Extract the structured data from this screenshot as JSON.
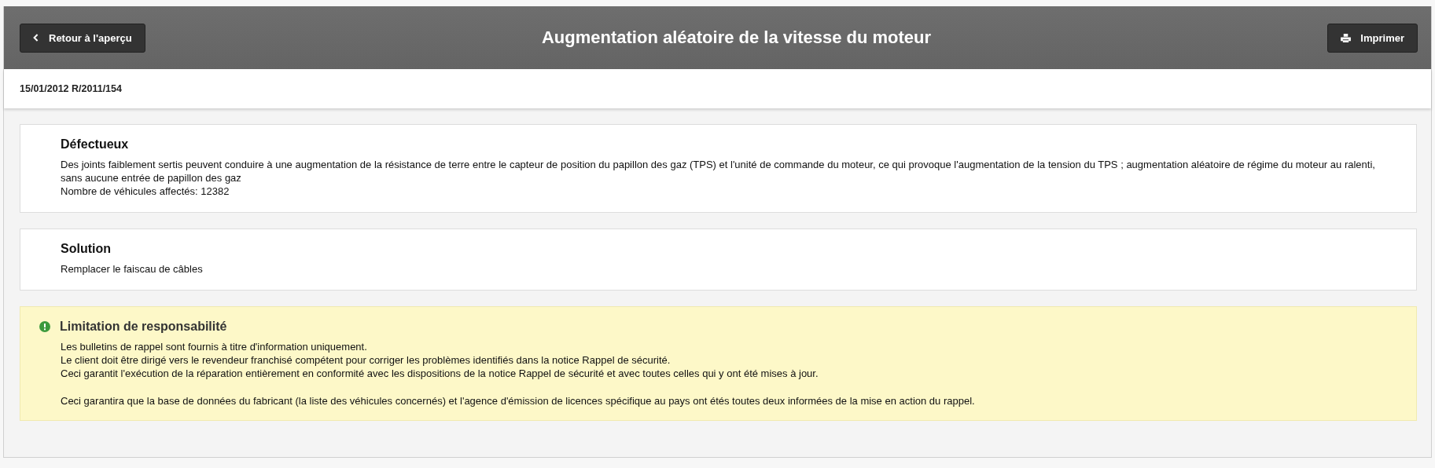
{
  "header": {
    "back_button": "Retour à l'aperçu",
    "title": "Augmentation aléatoire de la vitesse du moteur",
    "print_button": "Imprimer"
  },
  "reference": "15/01/2012 R/2011/154",
  "sections": [
    {
      "title": "Défectueux",
      "lines": [
        "Des joints faiblement sertis peuvent conduire à une augmentation de la résistance de terre entre le capteur de position du papillon des gaz (TPS) et l'unité de commande du moteur, ce qui provoque l'augmentation de la tension du TPS ; augmentation aléatoire de régime du moteur au ralenti, sans aucune entrée de papillon des gaz",
        "Nombre de véhicules affectés: 12382"
      ]
    },
    {
      "title": "Solution",
      "lines": [
        "Remplacer le faiscau de câbles"
      ]
    }
  ],
  "disclaimer": {
    "title": "Limitation de responsabilité",
    "paragraphs": [
      [
        "Les bulletins de rappel sont fournis à titre d'information uniquement.",
        "Le client doit être dirigé vers le revendeur franchisé compétent pour corriger les problèmes identifiés dans la notice Rappel de sécurité.",
        "Ceci garantit l'exécution de la réparation entièrement en conformité avec les dispositions de la notice Rappel de sécurité et avec toutes celles qui y ont été mises à jour."
      ],
      [
        "Ceci garantira que la base de données du fabricant (la liste des véhicules concernés) et l'agence d'émission de licences spécifique au pays ont étés toutes deux informées de la mise en action du rappel."
      ]
    ]
  }
}
